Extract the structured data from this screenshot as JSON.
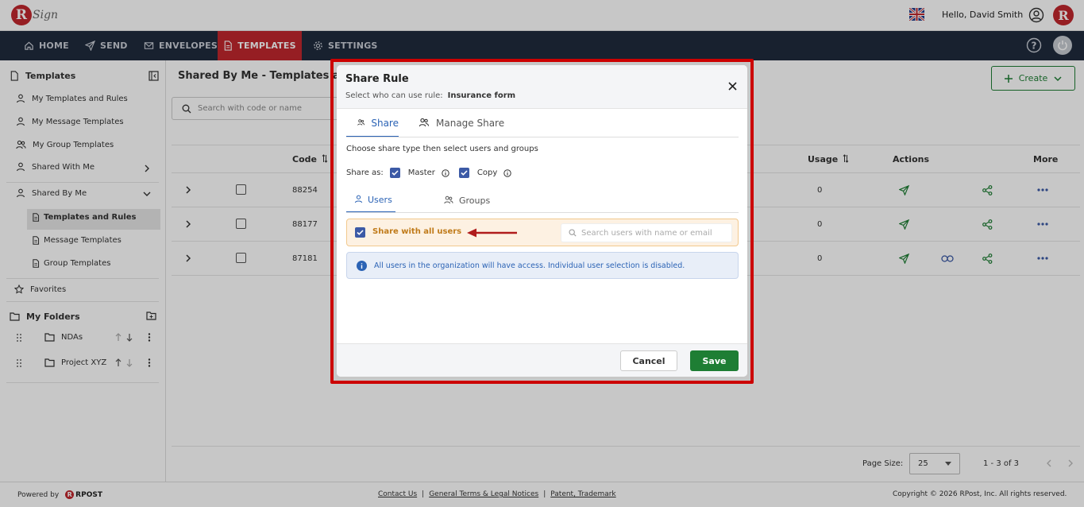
{
  "colors": {
    "brand": "#c1272d",
    "nav_bg": "#1f2b3d",
    "accent": "#3c5aa6",
    "save": "#1e7e34",
    "warn_bg": "#fdf1e2",
    "warn_text": "#c07b1a",
    "info_bg": "#e8eef8",
    "info_text": "#2b63b5",
    "arrow": "#b01c1c"
  },
  "header": {
    "logo_letter": "R",
    "logo_text": "Sign",
    "greeting": "Hello, David Smith",
    "avatar_letter": "R",
    "flag_icon": "uk-flag-icon"
  },
  "nav": {
    "items": [
      {
        "label": "HOME",
        "icon": "home-icon"
      },
      {
        "label": "SEND",
        "icon": "send-icon"
      },
      {
        "label": "ENVELOPES",
        "icon": "envelope-icon"
      },
      {
        "label": "TEMPLATES",
        "icon": "document-icon"
      },
      {
        "label": "SETTINGS",
        "icon": "gear-icon"
      }
    ],
    "active": "TEMPLATES"
  },
  "sidebar": {
    "title": "Templates",
    "items": [
      "My Templates and Rules",
      "My Message Templates",
      "My Group Templates",
      "Shared With Me",
      "Shared By Me"
    ],
    "sub_items": [
      "Templates and Rules",
      "Message Templates",
      "Group Templates"
    ],
    "favorites": "Favorites",
    "folders_title": "My Folders",
    "folders": [
      "NDAs",
      "Project XYZ"
    ]
  },
  "main": {
    "page_title": "Shared By Me - Templates ar",
    "search_placeholder": "Search with code or name",
    "create_label": "Create",
    "columns": {
      "code": "Code",
      "usage": "Usage",
      "actions": "Actions",
      "more": "More"
    },
    "rows": [
      {
        "code": "88254",
        "usage": "0"
      },
      {
        "code": "88177",
        "usage": "0"
      },
      {
        "code": "87181",
        "usage": "0"
      }
    ],
    "page_size_label": "Page Size:",
    "page_size_value": "25",
    "range": "1 - 3 of 3"
  },
  "footer": {
    "powered_by": "Powered by",
    "brand": "RPOST",
    "links": [
      "Contact Us",
      "General Terms & Legal Notices",
      "Patent, Trademark"
    ],
    "separator": "|",
    "copyright": "Copyright © 2026 RPost, Inc. All rights reserved."
  },
  "modal": {
    "title": "Share Rule",
    "subtitle_label": "Select who can use rule:",
    "subtitle_value": "Insurance form",
    "tabs": [
      "Share",
      "Manage Share"
    ],
    "instruction": "Choose share type then select users and groups",
    "share_as_label": "Share as:",
    "share_as_options": [
      {
        "label": "Master",
        "checked": true
      },
      {
        "label": "Copy",
        "checked": true
      }
    ],
    "subtabs": [
      "Users",
      "Groups"
    ],
    "share_all_label": "Share with all users",
    "share_all_checked": true,
    "user_search_placeholder": "Search users with name or email",
    "info_text": "All users in the organization will have access. Individual user selection is disabled.",
    "cancel_label": "Cancel",
    "save_label": "Save"
  }
}
